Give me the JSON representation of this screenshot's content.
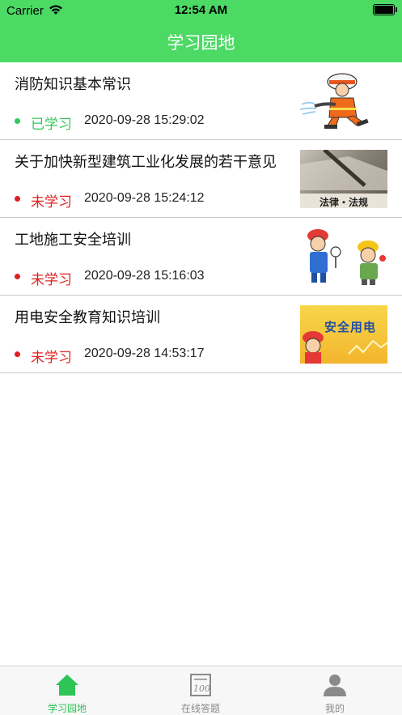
{
  "status_bar": {
    "carrier": "Carrier",
    "time": "12:54 AM"
  },
  "header": {
    "title": "学习园地"
  },
  "colors": {
    "brand": "#4cd964",
    "learned": "#34c759",
    "unlearned": "#e02020"
  },
  "items": [
    {
      "title": "消防知识基本常识",
      "status": "已学习",
      "date": "2020-09-28 15:29:02",
      "learned": true,
      "thumb_icon": "firefighter-illustration"
    },
    {
      "title": "关于加快新型建筑工业化发展的若干意见",
      "status": "未学习",
      "date": "2020-09-28 15:24:12",
      "learned": false,
      "thumb_caption": "法律・法规",
      "thumb_icon": "law-book-image"
    },
    {
      "title": "工地施工安全培训",
      "status": "未学习",
      "date": "2020-09-28 15:16:03",
      "learned": false,
      "thumb_icon": "construction-workers-illustration"
    },
    {
      "title": "用电安全教育知识培训",
      "status": "未学习",
      "date": "2020-09-28 14:53:17",
      "learned": false,
      "thumb_caption": "安全用电",
      "thumb_icon": "electric-safety-illustration"
    }
  ],
  "tabbar": {
    "tabs": [
      {
        "label": "学习园地",
        "icon": "home-icon",
        "active": true
      },
      {
        "label": "在线答题",
        "icon": "exam-paper-icon",
        "active": false
      },
      {
        "label": "我的",
        "icon": "person-icon",
        "active": false
      }
    ]
  }
}
